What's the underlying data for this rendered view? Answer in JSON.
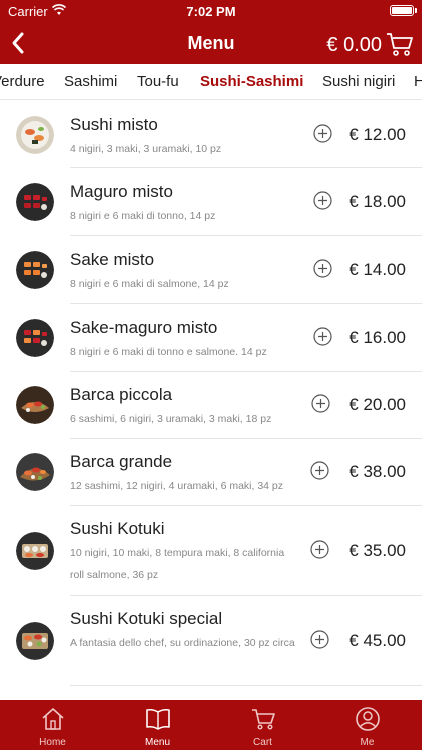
{
  "status": {
    "carrier": "Carrier",
    "time": "7:02 PM"
  },
  "nav": {
    "title": "Menu",
    "total": "€ 0.00"
  },
  "categories": [
    "Verdure",
    "Sashimi",
    "Tou-fu",
    "Sushi-Sashimi",
    "Sushi nigiri",
    "H"
  ],
  "active_category": "Sushi-Sashimi",
  "items": [
    {
      "name": "Sushi misto",
      "desc": "4 nigiri, 3 maki, 3 uramaki, 10 pz",
      "price": "€ 12.00"
    },
    {
      "name": "Maguro misto",
      "desc": "8 nigiri e 6 maki di tonno, 14 pz",
      "price": "€ 18.00"
    },
    {
      "name": "Sake misto",
      "desc": "8 nigiri e 6 maki di salmone, 14 pz",
      "price": "€ 14.00"
    },
    {
      "name": "Sake-maguro misto",
      "desc": "8 nigiri e 6 maki di tonno e salmone. 14 pz",
      "price": "€ 16.00"
    },
    {
      "name": "Barca piccola",
      "desc": "6 sashimi, 6 nigiri, 3 uramaki, 3 maki, 18 pz",
      "price": "€ 20.00"
    },
    {
      "name": "Barca grande",
      "desc": "12 sashimi, 12 nigiri, 4 uramaki, 6 maki, 34 pz",
      "price": "€ 38.00"
    },
    {
      "name": "Sushi Kotuki",
      "desc": "10 nigiri, 10 maki, 8 tempura maki, 8 california roll salmone, 36 pz",
      "price": "€ 35.00"
    },
    {
      "name": "Sushi Kotuki special",
      "desc": "A fantasia dello chef, su ordinazione, 30 pz circa",
      "price": "€ 45.00"
    }
  ],
  "tabbar": [
    {
      "label": "Home",
      "icon": "home-icon"
    },
    {
      "label": "Menu",
      "icon": "menu-book-icon"
    },
    {
      "label": "Cart",
      "icon": "cart-icon"
    },
    {
      "label": "Me",
      "icon": "profile-icon"
    }
  ],
  "active_tab": "Menu",
  "colors": {
    "brand": "#a80b0b",
    "active_text": "#a80b0b",
    "muted": "#888888"
  }
}
